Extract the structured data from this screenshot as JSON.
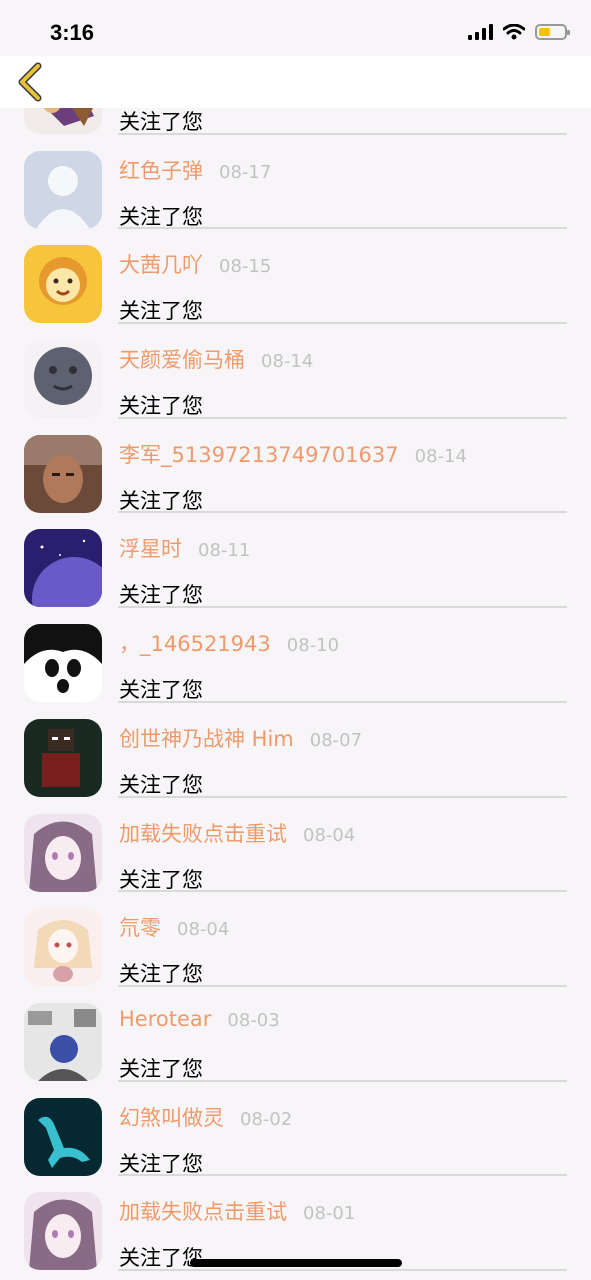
{
  "status_bar": {
    "time": "3:16"
  },
  "colors": {
    "name": "#ef9a6a",
    "date": "#c2c2c2",
    "back_arrow": "#e8c33a",
    "battery": "#f4c400"
  },
  "items": [
    {
      "name": "",
      "date": "",
      "action": "关注了您",
      "avatar": "cartoon-avatar"
    },
    {
      "name": "红色子弹",
      "date": "08-17",
      "action": "关注了您",
      "avatar": "default-avatar"
    },
    {
      "name": "大茜几吖",
      "date": "08-15",
      "action": "关注了您",
      "avatar": "lion-avatar"
    },
    {
      "name": "天颜爱偷马桶",
      "date": "08-14",
      "action": "关注了您",
      "avatar": "moon-avatar"
    },
    {
      "name": "李军_5139721374970163​7",
      "date": "08-14",
      "action": "关注了您",
      "avatar": "photo-avatar"
    },
    {
      "name": "浮星时",
      "date": "08-11",
      "action": "关注了您",
      "avatar": "galaxy-avatar"
    },
    {
      "name": "，_146521943",
      "date": "08-10",
      "action": "关注了您",
      "avatar": "anime-face-avatar"
    },
    {
      "name": "创世神乃战神 Him",
      "date": "08-07",
      "action": "关注了您",
      "avatar": "minecraft-avatar"
    },
    {
      "name": "加载失败点击重试",
      "date": "08-04",
      "action": "关注了您",
      "avatar": "anime-girl-avatar"
    },
    {
      "name": "氘零",
      "date": "08-04",
      "action": "关注了您",
      "avatar": "anime-girl-bunny-avatar"
    },
    {
      "name": "Herotear",
      "date": "08-03",
      "action": "关注了您",
      "avatar": "sketch-avatar"
    },
    {
      "name": "幻煞叫做灵",
      "date": "08-02",
      "action": "关注了您",
      "avatar": "dinosaur-avatar"
    },
    {
      "name": "加载失败点击重试",
      "date": "08-01",
      "action": "关注了您",
      "avatar": "anime-girl-avatar"
    }
  ]
}
